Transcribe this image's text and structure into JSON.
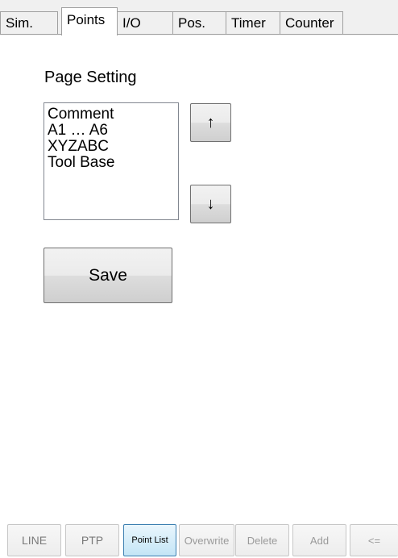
{
  "tabs": [
    {
      "label": "Sim.",
      "active": false
    },
    {
      "label": "Points",
      "active": true
    },
    {
      "label": "I/O",
      "active": false
    },
    {
      "label": "Pos.",
      "active": false
    },
    {
      "label": "Timer",
      "active": false
    },
    {
      "label": "Counter",
      "active": false
    }
  ],
  "page": {
    "title": "Page Setting",
    "list_items": [
      "Comment",
      "A1 … A6",
      "XYZABC",
      "Tool Base"
    ],
    "up_button": "↑",
    "down_button": "↓",
    "save_label": "Save"
  },
  "toolbar": {
    "line": "LINE",
    "ptp": "PTP",
    "point_list": "Point List",
    "overwrite": "Overwrite",
    "delete": "Delete",
    "add": "Add",
    "back": "<="
  }
}
